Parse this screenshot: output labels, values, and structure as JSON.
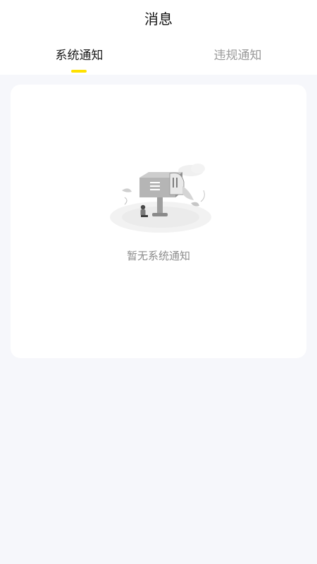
{
  "header": {
    "title": "消息"
  },
  "tabs": [
    {
      "label": "系统通知",
      "active": true
    },
    {
      "label": "违规通知",
      "active": false
    }
  ],
  "colors": {
    "accent_indicator": "#ffe100",
    "page_background": "#f6f7fb"
  },
  "empty_state": {
    "icon": "mailbox-illustration",
    "message": "暂无系统通知"
  }
}
